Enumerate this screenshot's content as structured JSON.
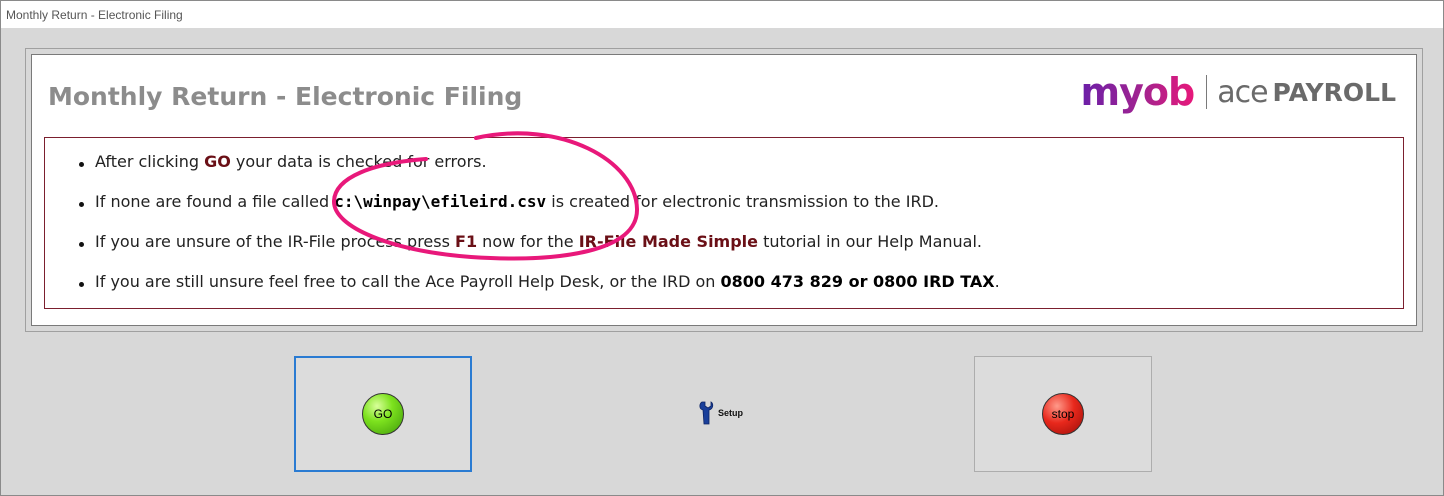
{
  "window": {
    "title": "Monthly Return - Electronic Filing"
  },
  "panel": {
    "title": "Monthly Return - Electronic Filing",
    "logo": {
      "brand": "myob",
      "product_light": "ace",
      "product_bold": "PAYROLL",
      "gradient_start": "#6b1fa8",
      "gradient_end": "#e8187a"
    }
  },
  "info": {
    "items": [
      {
        "t1": "After clicking ",
        "k1": "GO",
        "t2": " your data is checked for errors."
      },
      {
        "t1": "If none are found a file called ",
        "k1": "c:\\winpay\\efileird.csv",
        "t2": " is created for electronic transmission to the IRD."
      },
      {
        "t1": "If you are unsure of the IR-File process press ",
        "k1": "F1",
        "t2": " now for the ",
        "k2": "IR-File Made Simple",
        "t3": " tutorial in our Help Manual."
      },
      {
        "t1": "If you are still unsure feel free to call the Ace Payroll Help Desk, or the IRD on ",
        "k1": "0800 473 829 or 0800 IRD TAX",
        "t2": "."
      }
    ],
    "border_color": "#7b1f2e",
    "annotation_color": "#e8187a"
  },
  "buttons": {
    "go_label": "GO",
    "setup_label": "Setup",
    "stop_label": "stop",
    "focus_color": "#2a7bd2"
  }
}
